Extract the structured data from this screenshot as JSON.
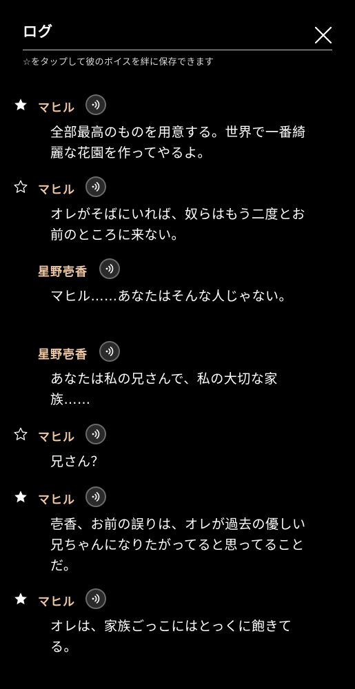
{
  "header": {
    "title": "ログ",
    "hint": "☆をタップして彼のボイスを絆に保存できます"
  },
  "entries": [
    {
      "speaker": "マヒル",
      "starred": true,
      "text": "全部最高のものを用意する。世界で一番綺麗な花園を作ってやるよ。"
    },
    {
      "speaker": "マヒル",
      "starred": false,
      "text": "オレがそばにいれば、奴らはもう二度とお前のところに来ない。"
    },
    {
      "speaker": "星野壱香",
      "starred": null,
      "text": "マヒル……あなたはそんな人じゃない。"
    },
    {
      "speaker": "星野壱香",
      "starred": null,
      "text": "あなたは私の兄さんで、私の大切な家族……"
    },
    {
      "speaker": "マヒル",
      "starred": false,
      "text": "兄さん？"
    },
    {
      "speaker": "マヒル",
      "starred": true,
      "text": "壱香、お前の誤りは、オレが過去の優しい兄ちゃんになりたがってると思ってることだ。"
    },
    {
      "speaker": "マヒル",
      "starred": true,
      "text": "オレは、家族ごっこにはとっくに飽きてる。"
    }
  ],
  "colors": {
    "background": "#000000",
    "speaker_name": "#f0c9a2",
    "text": "#ffffff"
  },
  "icons": {
    "close": "close-icon",
    "star_filled": "star-filled-icon",
    "star_outline": "star-outline-icon",
    "voice": "voice-play-icon"
  }
}
